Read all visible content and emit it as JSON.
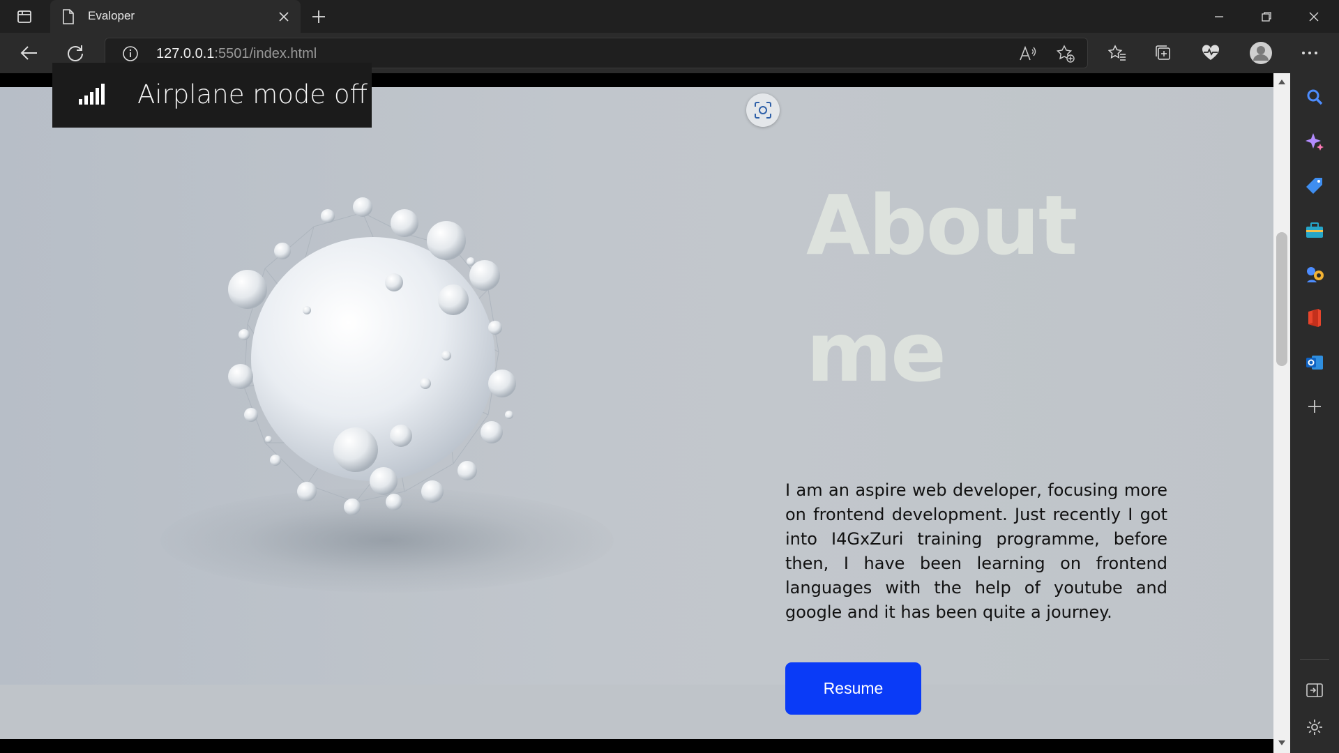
{
  "browser": {
    "tab_title": "Evaloper",
    "url_host": "127.0.0.1",
    "url_rest": ":5501/index.html"
  },
  "toast": {
    "text": "Airplane mode off",
    "icon": "signal-icon"
  },
  "page": {
    "about_title_line1": "About",
    "about_title_line2": "me",
    "about_text": "I am an aspire web developer, focusing more on frontend development. Just recently I got into I4GxZuri training programme, before then, I have been learning on frontend languages with the help of youtube and google and it has been quite a journey.",
    "resume_label": "Resume"
  },
  "colors": {
    "accent_button": "#0a3bf7",
    "title_color": "#dde2dd",
    "chrome_dark": "#202020"
  },
  "sidebar": {
    "icons": [
      "search-icon",
      "copilot-icon",
      "shopping-tag-icon",
      "tools-icon",
      "games-icon",
      "office-icon",
      "outlook-icon",
      "add-icon",
      "split-screen-icon",
      "settings-icon"
    ]
  }
}
